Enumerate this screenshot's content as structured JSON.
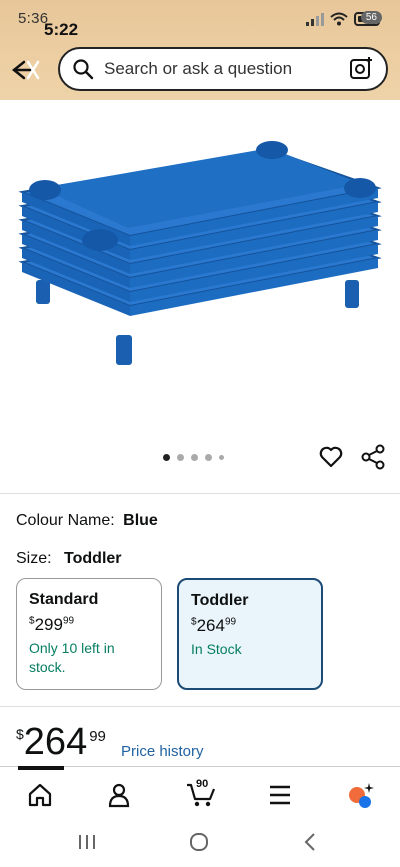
{
  "status_bar": {
    "time_under": "5:36",
    "time": "5:22",
    "battery_badge": "56"
  },
  "header": {
    "search_placeholder": "Search or ask a question",
    "back_icon": "back-arrow-icon",
    "search_icon": "search-icon",
    "camera_icon": "camera-lens-icon"
  },
  "product": {
    "image_name": "blue stackable cots",
    "carousel": {
      "count": 5,
      "active_index": 0
    }
  },
  "variation": {
    "colour_label": "Colour Name:",
    "colour_value": "Blue",
    "size_label": "Size:",
    "size_value": "Toddler",
    "options": [
      {
        "name": "Standard",
        "currency": "$",
        "whole": "299",
        "fraction": "99",
        "stock": "Only 10 left in stock.",
        "selected": false
      },
      {
        "name": "Toddler",
        "currency": "$",
        "whole": "264",
        "fraction": "99",
        "stock": "In Stock",
        "selected": true
      }
    ]
  },
  "price": {
    "currency": "$",
    "whole": "264",
    "fraction": "99",
    "history_link": "Price history"
  },
  "bottom_nav": {
    "cart_count": "90",
    "items": [
      "home-icon",
      "account-icon",
      "cart-icon",
      "menu-icon",
      "rufus-icon"
    ]
  },
  "colors": {
    "header_bg": "#e9caa0",
    "selected_border": "#1b4a75",
    "selected_bg": "#e9f5fb",
    "stock_green": "#067d62",
    "link_blue": "#2162a1",
    "cot_blue": "#1f6fc4"
  }
}
